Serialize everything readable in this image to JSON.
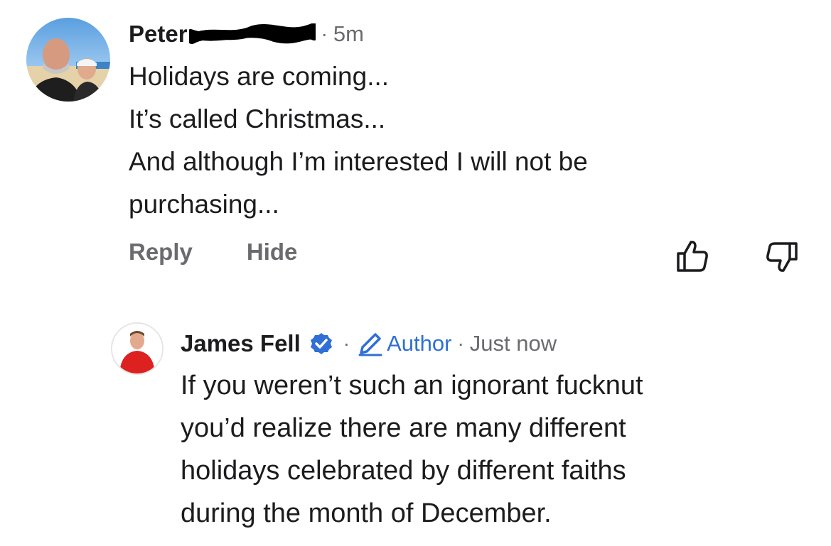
{
  "comment": {
    "author_name": "Peter",
    "time": "5m",
    "lines": [
      "Holidays are coming...",
      "It’s called Christmas...",
      "And although I’m interested I will not be",
      "purchasing..."
    ],
    "actions": {
      "reply_label": "Reply",
      "hide_label": "Hide"
    },
    "like_icon": "thumbs-up-icon",
    "dislike_icon": "thumbs-down-icon"
  },
  "reply": {
    "author_name": "James Fell",
    "verified_icon": "verified-badge-icon",
    "badge_icon": "pencil-icon",
    "badge_label": "Author",
    "time": "Just now",
    "lines": [
      "If you weren’t such an ignorant fucknut",
      "you’d realize there are many different",
      "holidays celebrated by different faiths",
      "during the month of December."
    ]
  },
  "colors": {
    "text": "#1c1c1e",
    "muted": "#6b6b6f",
    "accent": "#2f6fd6"
  }
}
